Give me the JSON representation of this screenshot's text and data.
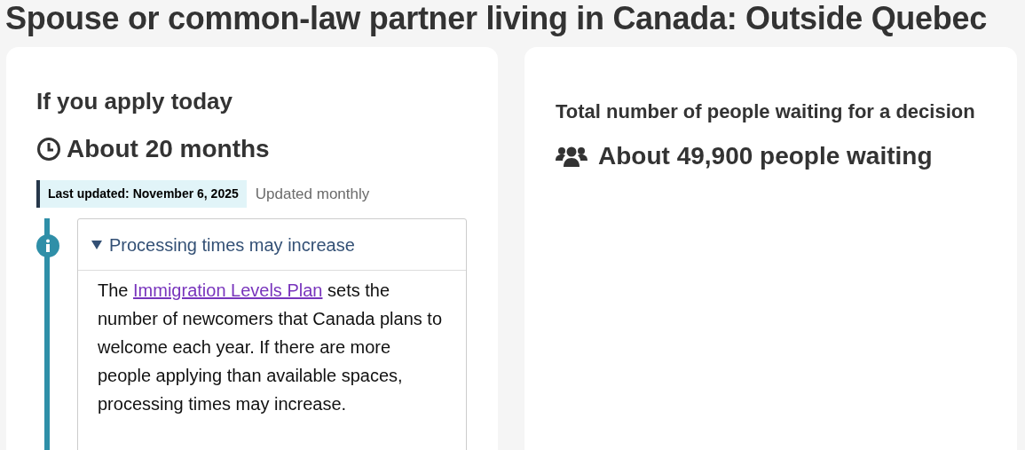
{
  "title": "Spouse or common-law partner living in Canada: Outside Quebec",
  "processing_time": {
    "heading": "If you apply today",
    "estimate": "About 20 months",
    "last_updated": "Last updated: November 6, 2025",
    "update_frequency": "Updated monthly",
    "notice": {
      "summary": "Processing times may increase",
      "expanded": true,
      "text_before": "The",
      "link": "Immigration Levels Plan",
      "text_after": "sets the number of newcomers that Canada plans to welcome each year. If there are more people applying than available spaces, processing times may increase."
    }
  },
  "waiting": {
    "heading": "Total number of people waiting for a decision",
    "count": "About 49,900 people waiting"
  }
}
